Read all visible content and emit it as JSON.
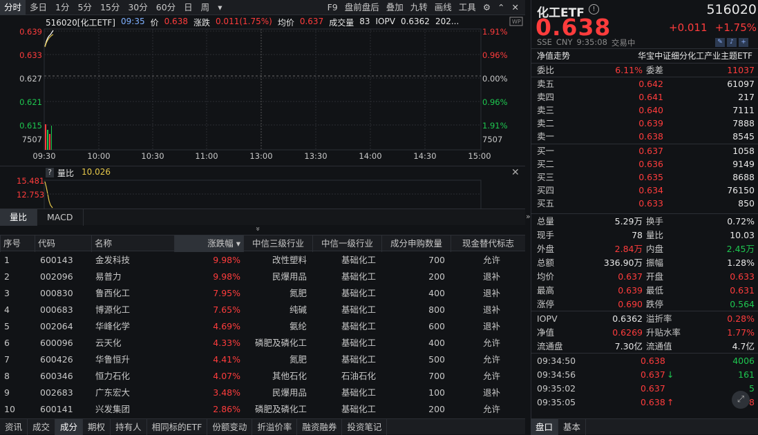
{
  "toolbar": {
    "periods": [
      "分时",
      "多日",
      "1分",
      "5分",
      "15分",
      "30分",
      "60分",
      "日",
      "周"
    ],
    "more": "▾",
    "right": [
      "F9",
      "盘前盘后",
      "叠加",
      "九转",
      "画线",
      "工具"
    ]
  },
  "chart": {
    "symbol": "516020[化工ETF]",
    "time": "09:35",
    "price_label": "价",
    "price": "0.638",
    "change_label": "涨跌",
    "change": "0.011(1.75%)",
    "avg_label": "均价",
    "avg": "0.637",
    "vol_label": "成交量",
    "vol": "83",
    "iopv_label": "IOPV",
    "iopv": "0.6362",
    "year": "202...",
    "y_left": [
      "0.639",
      "0.633",
      "0.627",
      "0.621",
      "0.615",
      "7507"
    ],
    "y_right": [
      "1.91%",
      "0.96%",
      "0.00%",
      "0.96%",
      "1.91%",
      "7507"
    ],
    "x_ticks": [
      "09:30",
      "10:00",
      "10:30",
      "11:00",
      "13:00",
      "13:30",
      "14:00",
      "14:30",
      "15:00"
    ]
  },
  "volume": {
    "help": "?",
    "label": "量比",
    "value": "10.026",
    "y": [
      "15.481",
      "12.753"
    ],
    "tabs": [
      "量比",
      "MACD"
    ],
    "collapse": "»"
  },
  "table": {
    "headers": [
      "序号",
      "代码",
      "名称",
      "涨跌幅 ▾",
      "中信三级行业",
      "中信一级行业",
      "成分申购数量",
      "现金替代标志"
    ],
    "rows": [
      [
        "1",
        "600143",
        "金发科技",
        "9.98%",
        "改性塑料",
        "基础化工",
        "700",
        "允许"
      ],
      [
        "2",
        "002096",
        "易普力",
        "9.98%",
        "民爆用品",
        "基础化工",
        "200",
        "退补"
      ],
      [
        "3",
        "000830",
        "鲁西化工",
        "7.95%",
        "氮肥",
        "基础化工",
        "400",
        "退补"
      ],
      [
        "4",
        "000683",
        "博源化工",
        "7.65%",
        "纯碱",
        "基础化工",
        "800",
        "退补"
      ],
      [
        "5",
        "002064",
        "华峰化学",
        "4.69%",
        "氨纶",
        "基础化工",
        "600",
        "退补"
      ],
      [
        "6",
        "600096",
        "云天化",
        "4.33%",
        "磷肥及磷化工",
        "基础化工",
        "400",
        "允许"
      ],
      [
        "7",
        "600426",
        "华鲁恒升",
        "4.41%",
        "氮肥",
        "基础化工",
        "500",
        "允许"
      ],
      [
        "8",
        "600346",
        "恒力石化",
        "4.07%",
        "其他石化",
        "石油石化",
        "700",
        "允许"
      ],
      [
        "9",
        "002683",
        "广东宏大",
        "3.48%",
        "民爆用品",
        "基础化工",
        "100",
        "退补"
      ],
      [
        "10",
        "600141",
        "兴发集团",
        "2.86%",
        "磷肥及磷化工",
        "基础化工",
        "200",
        "允许"
      ]
    ]
  },
  "bottom_tabs": [
    "资讯",
    "成交",
    "成分",
    "期权",
    "持有人",
    "相同标的ETF",
    "份额变动",
    "折溢价率",
    "融资融券",
    "投资笔记"
  ],
  "quote": {
    "name": "化工ETF",
    "code": "516020",
    "price": "0.638",
    "change": "+0.011",
    "pct": "+1.75%",
    "exchange": "SSE",
    "currency": "CNY",
    "time": "9:35:08",
    "status": "交易中",
    "nav_trend": "净值走势",
    "index_name": "华宝中证细分化工产业主题ETF",
    "wei_bi_label": "委比",
    "wei_bi": "6.11%",
    "wei_cha_label": "委差",
    "wei_cha": "11037",
    "asks": [
      [
        "卖五",
        "0.642",
        "61097"
      ],
      [
        "卖四",
        "0.641",
        "217"
      ],
      [
        "卖三",
        "0.640",
        "7111"
      ],
      [
        "卖二",
        "0.639",
        "7888"
      ],
      [
        "卖一",
        "0.638",
        "8545"
      ]
    ],
    "bids": [
      [
        "买一",
        "0.637",
        "1058"
      ],
      [
        "买二",
        "0.636",
        "9149"
      ],
      [
        "买三",
        "0.635",
        "8688"
      ],
      [
        "买四",
        "0.634",
        "76150"
      ],
      [
        "买五",
        "0.633",
        "850"
      ]
    ],
    "stats": [
      [
        "总量",
        "5.29万",
        "换手",
        "0.72%"
      ],
      [
        "现手",
        "78",
        "量比",
        "10.03"
      ],
      [
        "外盘",
        "2.84万",
        "内盘",
        "2.45万"
      ],
      [
        "总额",
        "336.90万",
        "振幅",
        "1.28%"
      ],
      [
        "均价",
        "0.637",
        "开盘",
        "0.633"
      ],
      [
        "最高",
        "0.639",
        "最低",
        "0.631"
      ],
      [
        "涨停",
        "0.690",
        "跌停",
        "0.564"
      ]
    ],
    "stats2": [
      [
        "IOPV",
        "0.6362",
        "溢折率",
        "0.28%"
      ],
      [
        "净值",
        "0.6269",
        "升贴水率",
        "1.77%"
      ],
      [
        "流通盘",
        "7.30亿",
        "流通值",
        "4.7亿"
      ]
    ],
    "ticks": [
      [
        "09:34:50",
        "0.638",
        "",
        "4006"
      ],
      [
        "09:34:56",
        "0.637",
        "↓",
        "161"
      ],
      [
        "09:35:02",
        "0.637",
        "",
        "5"
      ],
      [
        "09:35:05",
        "0.638",
        "↑",
        "78"
      ]
    ],
    "tabs": [
      "盘口",
      "基本"
    ]
  },
  "colors": {
    "up": "#ff3c3c",
    "down": "#1ec850",
    "bg": "#111316"
  }
}
